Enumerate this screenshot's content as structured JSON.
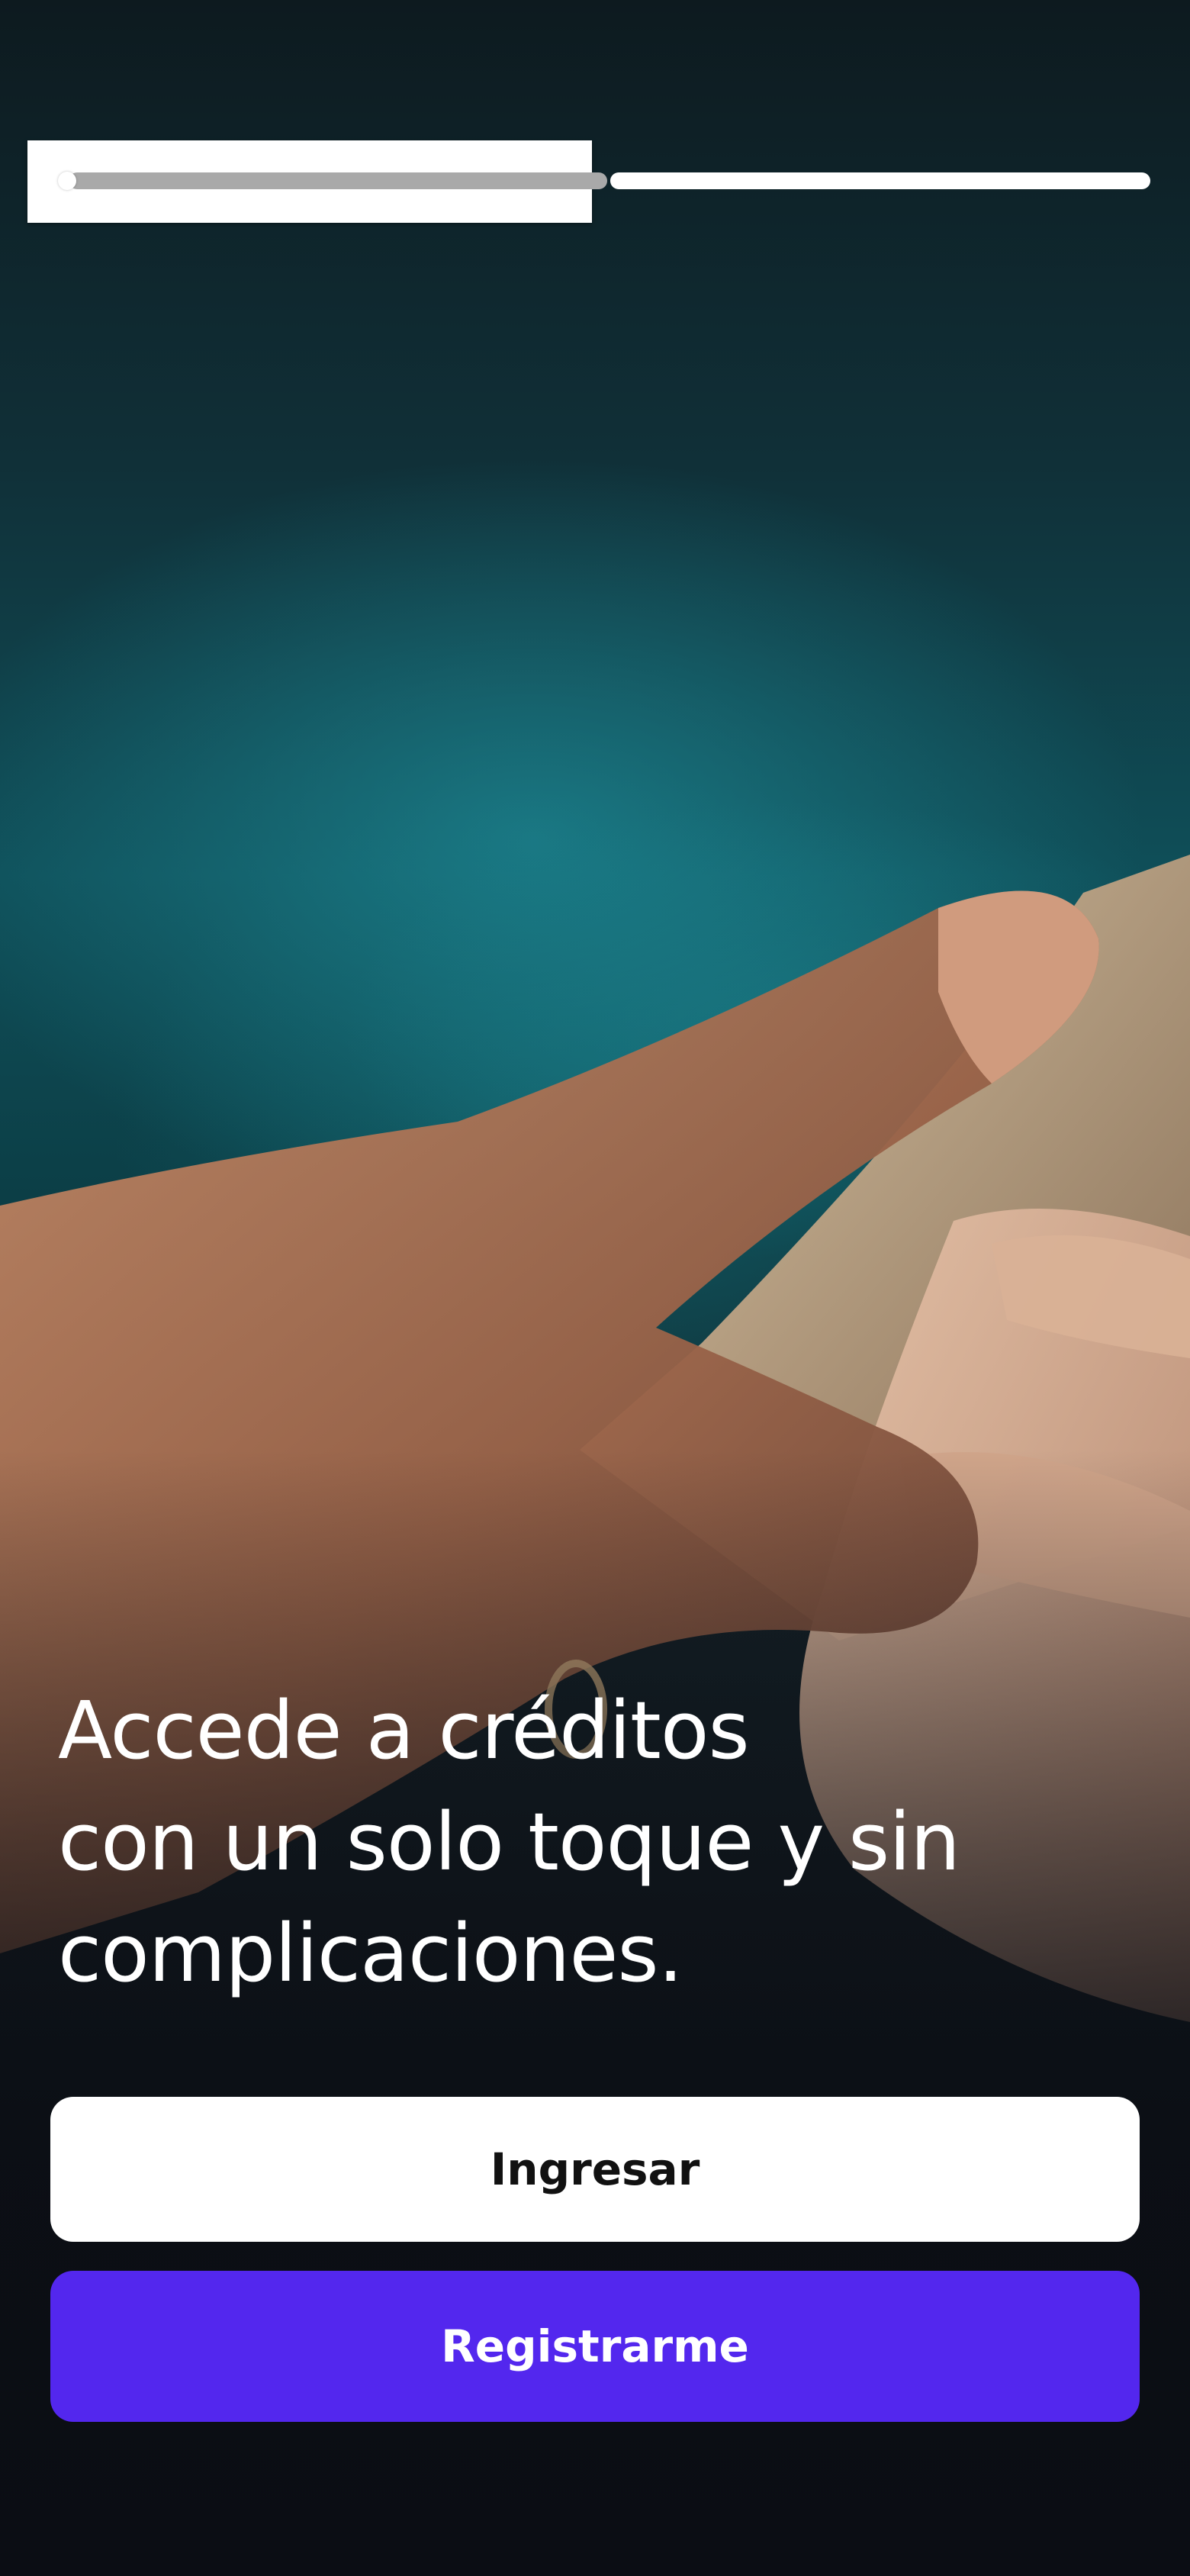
{
  "stories": {
    "active_index": 1,
    "count": 2
  },
  "hero": {
    "line1": "Accede a créditos",
    "line2": "con un solo toque y sin",
    "line3": "complicaciones."
  },
  "actions": {
    "login_label": "Ingresar",
    "register_label": "Registrarme"
  },
  "colors": {
    "primary": "#5327EE",
    "button_light": "#FFFFFF"
  }
}
